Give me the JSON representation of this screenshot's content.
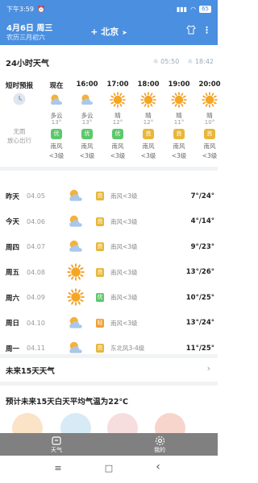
{
  "status_bar": {
    "time": "下午3:59",
    "battery": "65"
  },
  "header": {
    "date": "4月6日 周三",
    "lunar": "农历三月初六",
    "city": "北京",
    "plus": "+",
    "locate": "➤"
  },
  "section_title": "24小时天气",
  "sun_times": {
    "sunrise": "05:50",
    "sunset": "18:42"
  },
  "short_forecast": {
    "label": "短时预报",
    "text1": "无雨",
    "text2": "放心出行"
  },
  "hourly": [
    {
      "time": "现在",
      "icon": "partly-cloudy",
      "condition": "多云",
      "temp": "13°",
      "aqi": "优",
      "aqi_color": "#5dc86b",
      "wind": "南风",
      "level": "<3级"
    },
    {
      "time": "16:00",
      "icon": "partly-cloudy",
      "condition": "多云",
      "temp": "13°",
      "aqi": "优",
      "aqi_color": "#5dc86b",
      "wind": "南风",
      "level": "<3级"
    },
    {
      "time": "17:00",
      "icon": "sun",
      "condition": "晴",
      "temp": "12°",
      "aqi": "优",
      "aqi_color": "#5dc86b",
      "wind": "南风",
      "level": "<3级"
    },
    {
      "time": "18:00",
      "icon": "sun",
      "condition": "晴",
      "temp": "12°",
      "aqi": "良",
      "aqi_color": "#e8b73a",
      "wind": "南风",
      "level": "<3级"
    },
    {
      "time": "19:00",
      "icon": "sun",
      "condition": "晴",
      "temp": "11°",
      "aqi": "良",
      "aqi_color": "#e8b73a",
      "wind": "南风",
      "level": "<3级"
    },
    {
      "time": "20:00",
      "icon": "sun",
      "condition": "晴",
      "temp": "10°",
      "aqi": "良",
      "aqi_color": "#e8b73a",
      "wind": "南风",
      "level": "<3级"
    }
  ],
  "daily": [
    {
      "day": "昨天",
      "date": "04.05",
      "icon": "partly-cloudy",
      "aqi": "良",
      "aqi_color": "#e8b73a",
      "wind": "南风<3级",
      "temp": "7°/24°"
    },
    {
      "day": "今天",
      "date": "04.06",
      "icon": "partly-cloudy",
      "aqi": "良",
      "aqi_color": "#e8b73a",
      "wind": "南风<3级",
      "temp": "4°/14°"
    },
    {
      "day": "周四",
      "date": "04.07",
      "icon": "partly-cloudy",
      "aqi": "良",
      "aqi_color": "#e8b73a",
      "wind": "南风<3级",
      "temp": "9°/23°"
    },
    {
      "day": "周五",
      "date": "04.08",
      "icon": "sun",
      "aqi": "良",
      "aqi_color": "#e8b73a",
      "wind": "南风<3级",
      "temp": "13°/26°"
    },
    {
      "day": "周六",
      "date": "04.09",
      "icon": "sun",
      "aqi": "优",
      "aqi_color": "#5dc86b",
      "wind": "南风<3级",
      "temp": "10°/25°"
    },
    {
      "day": "周日",
      "date": "04.10",
      "icon": "partly-cloudy",
      "aqi": "轻",
      "aqi_color": "#f0a030",
      "wind": "南风<3级",
      "temp": "13°/24°"
    },
    {
      "day": "周一",
      "date": "04.11",
      "icon": "partly-cloudy",
      "aqi": "良",
      "aqi_color": "#e8b73a",
      "wind": "东北风3-4级",
      "temp": "11°/25°"
    }
  ],
  "more_15": "未来15天天气",
  "more_15_arrow": "›",
  "avg_text": "预计未来15天白天平均气温为22℃",
  "tabs": [
    {
      "label": "天气"
    },
    {
      "label": "我的"
    }
  ],
  "nav": {
    "menu": "≡",
    "home": "□",
    "back": "‹"
  },
  "colors": {
    "header_bg": "#4a8fe0",
    "tabbar_bg": "#808080"
  }
}
